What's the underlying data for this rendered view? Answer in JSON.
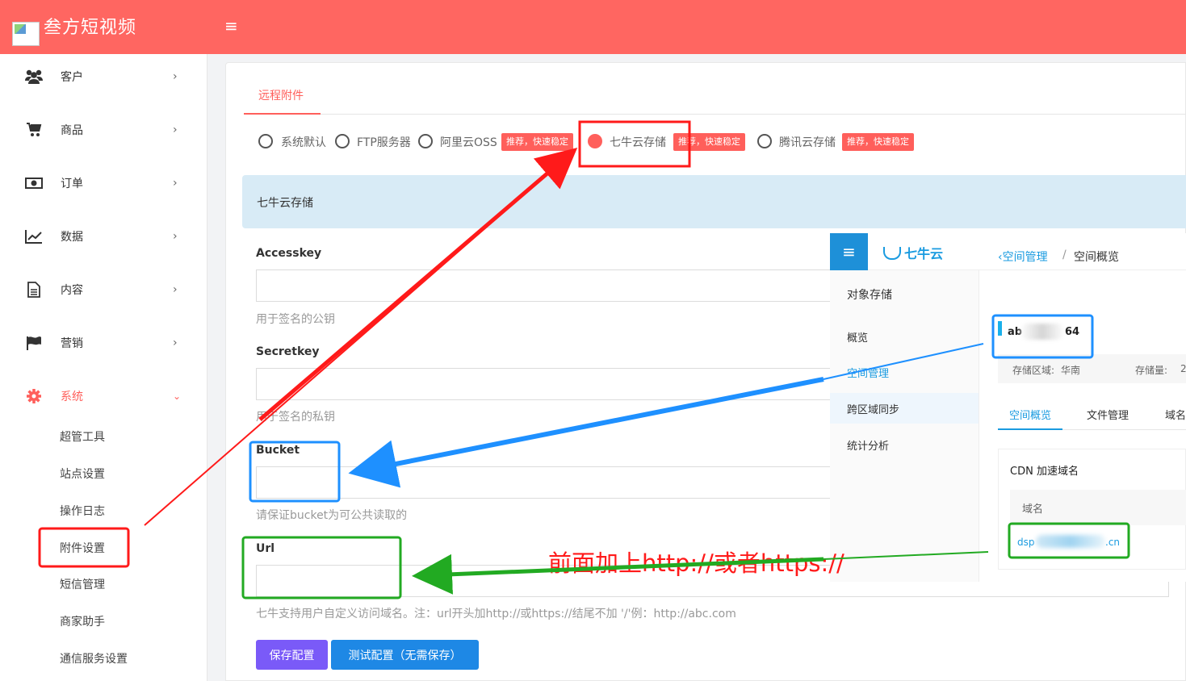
{
  "brand": {
    "title": "叁方短视频",
    "menu_icon": "≡"
  },
  "sidebar": {
    "items": [
      {
        "label": "客户",
        "icon": "users-icon"
      },
      {
        "label": "商品",
        "icon": "cart-icon"
      },
      {
        "label": "订单",
        "icon": "money-icon"
      },
      {
        "label": "数据",
        "icon": "chart-line-icon"
      },
      {
        "label": "内容",
        "icon": "document-icon"
      },
      {
        "label": "营销",
        "icon": "flag-icon"
      },
      {
        "label": "系统",
        "icon": "gear-icon"
      }
    ],
    "sub_items": [
      "超管工具",
      "站点设置",
      "操作日志",
      "附件设置",
      "短信管理",
      "商家助手",
      "通信服务设置"
    ]
  },
  "tabs": {
    "active": "远程附件"
  },
  "storage_options": {
    "items": [
      "系统默认",
      "FTP服务器",
      "阿里云OSS",
      "七牛云存储",
      "腾讯云存储"
    ],
    "badge": "推荐，快速稳定",
    "selected": "七牛云存储"
  },
  "section": {
    "title": "七牛云存储"
  },
  "form": {
    "accesskey": {
      "label": "Accesskey",
      "value": "",
      "help": "用于签名的公钥"
    },
    "secretkey": {
      "label": "Secretkey",
      "value": "",
      "help": "用于签名的私钥"
    },
    "bucket": {
      "label": "Bucket",
      "value": "",
      "help": "请保证bucket为可公共读取的"
    },
    "url": {
      "label": "Url",
      "value": "",
      "help": "七牛支持用户自定义访问域名。注：url开头加http://或https://结尾不加 '/'例：http://abc.com"
    }
  },
  "buttons": {
    "save": "保存配置",
    "test": "测试配置（无需保存）"
  },
  "qiniu_panel": {
    "logo": "七牛云",
    "nav": [
      "对象存储",
      "概览",
      "空间管理",
      "跨区域同步",
      "统计分析"
    ],
    "selected_nav": "空间管理",
    "breadcrumb": {
      "link": "空间管理",
      "separator": "/",
      "current": "空间概览"
    },
    "bucket_name_start": "ab",
    "bucket_name_end": "64",
    "region_label": "存储区域:",
    "region_value": "华南",
    "storage_label": "存储量:",
    "storage_value": "2",
    "tabs": [
      "空间概览",
      "文件管理",
      "域名"
    ],
    "cdn_title": "CDN 加速域名",
    "domain_header": "域名",
    "domain_start": "dsp",
    "domain_end": ".cn"
  },
  "annotation": {
    "text": "前面加上http://或者https://"
  },
  "colors": {
    "brand": "#ff6661",
    "accent_red": "#ff5f5b",
    "highlight_red": "#ff1a1a",
    "highlight_blue": "#1e90ff",
    "highlight_green": "#22aa22",
    "qiniu_blue": "#1a9be0"
  }
}
